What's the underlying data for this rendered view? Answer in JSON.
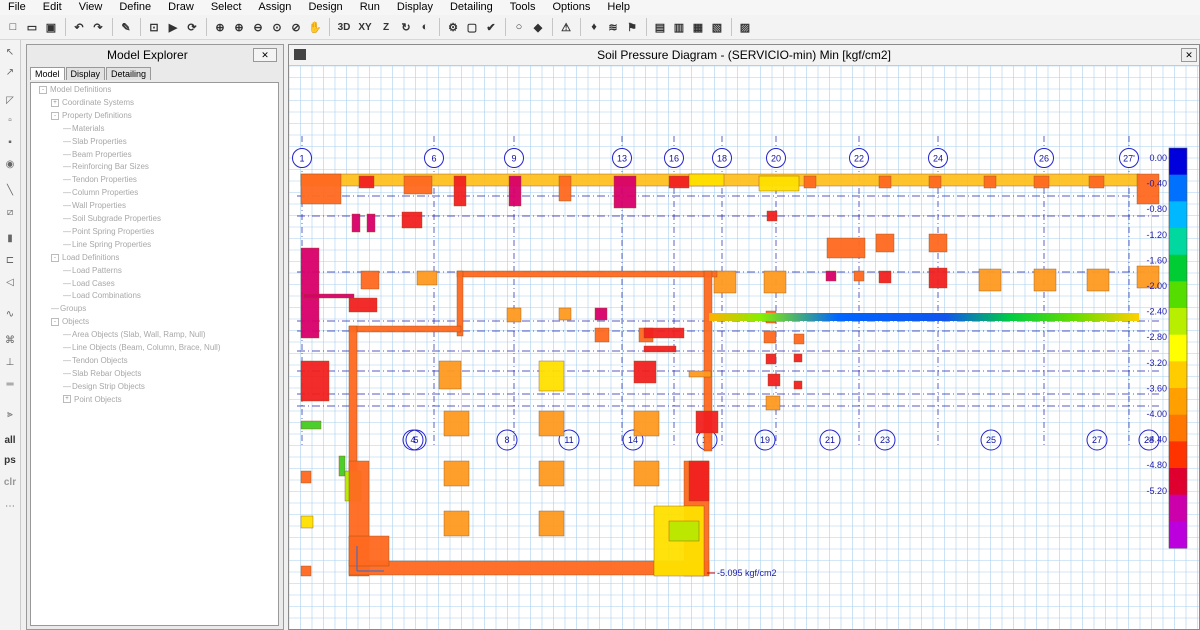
{
  "menu": [
    "File",
    "Edit",
    "View",
    "Define",
    "Draw",
    "Select",
    "Assign",
    "Design",
    "Run",
    "Display",
    "Detailing",
    "Tools",
    "Options",
    "Help"
  ],
  "toolbar_text": [
    "3D",
    "XY",
    "Z"
  ],
  "sidebar_text": [
    "all",
    "ps",
    "clr"
  ],
  "explorer": {
    "title": "Model Explorer",
    "close_icon": "close-icon",
    "tabs": [
      "Model",
      "Display",
      "Detailing"
    ],
    "tree": [
      {
        "label": "Model Definitions",
        "level": 0,
        "toggle": "-"
      },
      {
        "label": "Coordinate Systems",
        "level": 1,
        "toggle": "+"
      },
      {
        "label": "Property Definitions",
        "level": 1,
        "toggle": "-"
      },
      {
        "label": "Materials",
        "level": 2,
        "toggle": ""
      },
      {
        "label": "Slab Properties",
        "level": 2,
        "toggle": ""
      },
      {
        "label": "Beam Properties",
        "level": 2,
        "toggle": ""
      },
      {
        "label": "Reinforcing Bar Sizes",
        "level": 2,
        "toggle": ""
      },
      {
        "label": "Tendon Properties",
        "level": 2,
        "toggle": ""
      },
      {
        "label": "Column Properties",
        "level": 2,
        "toggle": ""
      },
      {
        "label": "Wall Properties",
        "level": 2,
        "toggle": ""
      },
      {
        "label": "Soil Subgrade Properties",
        "level": 2,
        "toggle": ""
      },
      {
        "label": "Point Spring Properties",
        "level": 2,
        "toggle": ""
      },
      {
        "label": "Line Spring Properties",
        "level": 2,
        "toggle": ""
      },
      {
        "label": "Load Definitions",
        "level": 1,
        "toggle": "-"
      },
      {
        "label": "Load Patterns",
        "level": 2,
        "toggle": ""
      },
      {
        "label": "Load Cases",
        "level": 2,
        "toggle": ""
      },
      {
        "label": "Load Combinations",
        "level": 2,
        "toggle": ""
      },
      {
        "label": "Groups",
        "level": 1,
        "toggle": ""
      },
      {
        "label": "Objects",
        "level": 1,
        "toggle": "-"
      },
      {
        "label": "Area Objects (Slab, Wall, Ramp, Null)",
        "level": 2,
        "toggle": ""
      },
      {
        "label": "Line Objects (Beam, Column, Brace, Null)",
        "level": 2,
        "toggle": ""
      },
      {
        "label": "Tendon Objects",
        "level": 2,
        "toggle": ""
      },
      {
        "label": "Slab Rebar Objects",
        "level": 2,
        "toggle": ""
      },
      {
        "label": "Design Strip Objects",
        "level": 2,
        "toggle": ""
      },
      {
        "label": "Point Objects",
        "level": 2,
        "toggle": "+"
      }
    ]
  },
  "viewer": {
    "title": "Soil Pressure Diagram - (SERVICIO-min)  Min  [kgf/cm2]"
  },
  "legend": {
    "values": [
      "0.00",
      "-0.40",
      "-0.80",
      "-1.20",
      "-1.60",
      "-2.00",
      "-2.40",
      "-2.80",
      "-3.20",
      "-3.60",
      "-4.00",
      "-4.40",
      "-4.80",
      "-5.20"
    ],
    "colors": [
      "#0000dd",
      "#0070ff",
      "#00b8ff",
      "#00d8a0",
      "#00cc33",
      "#55dd00",
      "#b8ee00",
      "#ffff00",
      "#ffcc00",
      "#ffa000",
      "#ff7700",
      "#ff3300",
      "#e00030",
      "#cc00aa",
      "#bb00dd"
    ]
  },
  "annotation": "-5.095 kgf/cm2",
  "grid_top": [
    "1",
    "6",
    "9",
    "13",
    "16",
    "18",
    "20",
    "22",
    "24",
    "26",
    "27'"
  ],
  "grid_bottom": [
    "4",
    "5",
    "8",
    "11",
    "14",
    "17",
    "19",
    "21",
    "23",
    "25",
    "27",
    "28"
  ]
}
